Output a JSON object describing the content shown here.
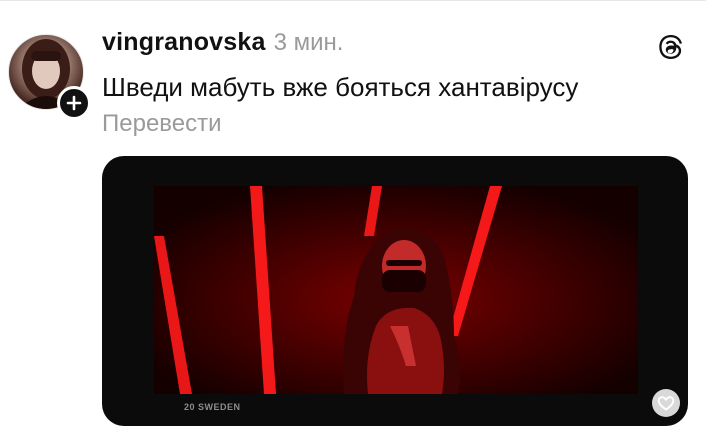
{
  "post": {
    "username": "vingranovska",
    "time": "3 мин.",
    "text": "Шведи мабуть вже бояться хантавірусу",
    "translate_label": "Перевести"
  },
  "icons": {
    "follow": "plus-icon",
    "app": "threads-logo-icon",
    "like": "heart-icon"
  },
  "media": {
    "caption": "20 SWEDEN"
  },
  "colors": {
    "text": "#111111",
    "muted": "#9a9a9a",
    "video_red": "#ff1a1a",
    "media_bg": "#0b0b0b"
  }
}
